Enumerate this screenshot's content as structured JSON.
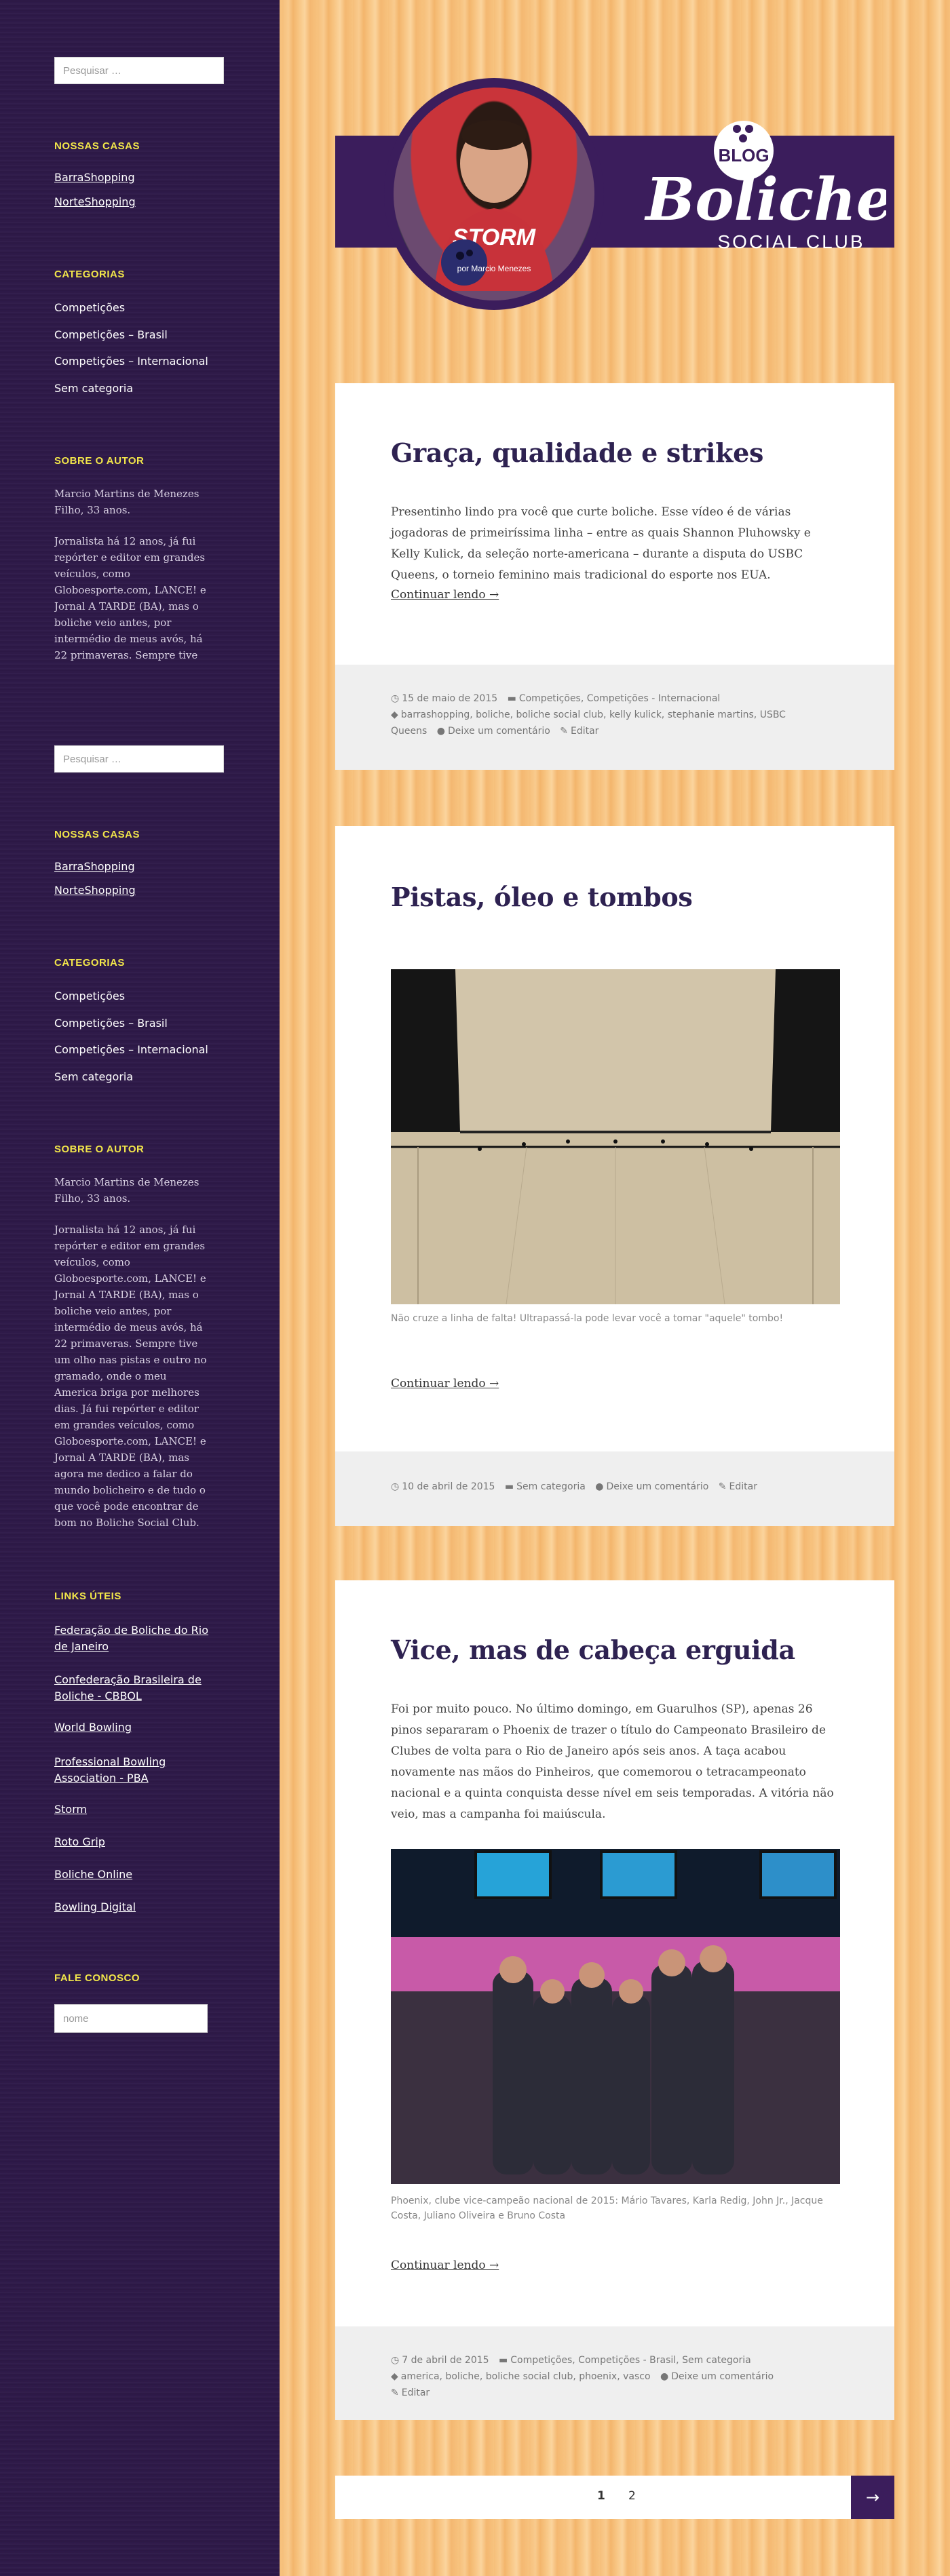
{
  "sidebar": {
    "search_placeholder": "Pesquisar …",
    "houses_title": "NOSSAS CASAS",
    "houses": [
      "BarraShopping",
      "NorteShopping"
    ],
    "categories_title": "CATEGORIAS",
    "categories": [
      "Competições",
      "Competições – Brasil",
      "Competições – Internacional",
      "Sem categoria"
    ],
    "author_title": "SOBRE O AUTOR",
    "author_short": "Marcio Martins de Menezes Filho, 33 anos.",
    "author_bio_truncated": "Jornalista há 12 anos, já fui repórter e editor em grandes veículos, como Globoesporte.com, LANCE! e Jornal A TARDE (BA), mas o boliche veio antes, por intermédio de meus avós, há 22 primaveras. Sempre tive um",
    "author_bio_full": "Jornalista há 12 anos, já fui repórter e editor em grandes veículos, como Globoesporte.com, LANCE! e Jornal A TARDE (BA), mas o boliche veio antes, por intermédio de meus avós, há 22 primaveras. Sempre tive um olho nas pistas e outro no gramado, onde o meu America briga por melhores dias. Já fui repórter e editor em grandes veículos, como Globoesporte.com, LANCE! e Jornal A TARDE (BA), mas agora me dedico a falar do mundo bolicheiro e de tudo o que você pode encontrar de bom no Boliche Social Club.",
    "links_title": "LINKS ÚTEIS",
    "links": [
      "Federação de Boliche do Rio de Janeiro",
      "Confederação Brasileira de Boliche - CBBOL",
      "World Bowling",
      "Professional Bowling Association - PBA",
      "Storm",
      "Roto Grip",
      "Boliche Online",
      "Bowling Digital"
    ],
    "contact_title": "FALE CONOSCO",
    "contact_placeholder": "nome"
  },
  "header": {
    "avatar_caption": "por Marcio Menezes",
    "logo_blog": "BLOG",
    "logo_main": "Boliche",
    "logo_sub": "SOCIAL CLUB"
  },
  "posts": [
    {
      "title": "Graça, qualidade e strikes",
      "excerpt": "Presentinho lindo pra você que curte boliche. Esse vídeo é de várias jogadoras de primeiríssima linha – entre as quais Shannon Pluhowsky e Kelly Kulick, da seleção norte-americana – durante a disputa do USBC Queens, o torneio feminino mais tradicional do esporte nos EUA.",
      "read_more": "Continuar lendo →",
      "date": "15 de maio de 2015",
      "categories": "Competições, Competições - Internacional",
      "tags": "barrashopping, boliche, boliche social club, kelly kulick, stephanie martins, USBC Queens",
      "comment": "Deixe um comentário",
      "edit": "Editar"
    },
    {
      "title": "Pistas, óleo e tombos",
      "caption": "Não cruze a linha de falta! Ultrapassá-la pode levar você a tomar \"aquele\" tombo!",
      "read_more": "Continuar lendo →",
      "date": "10 de abril de 2015",
      "categories": "Sem categoria",
      "comment": "Deixe um comentário",
      "edit": "Editar"
    },
    {
      "title": "Vice, mas de cabeça erguida",
      "excerpt": "Foi por muito pouco. No último domingo, em Guarulhos (SP), apenas 26 pinos separaram o Phoenix de trazer o título do Campeonato Brasileiro de Clubes de volta para o Rio de Janeiro após seis anos. A taça acabou novamente nas mãos do Pinheiros, que comemorou o tetracampeonato nacional e a quinta conquista desse nível em seis temporadas. A vitória não veio, mas a campanha foi maiúscula.",
      "caption": "Phoenix, clube vice-campeão nacional de 2015: Mário Tavares, Karla Redig, John Jr., Jacque Costa, Juliano Oliveira e Bruno Costa",
      "read_more": "Continuar lendo →",
      "date": "7 de abril de 2015",
      "categories": "Competições, Competições - Brasil, Sem categoria",
      "tags": "america, boliche, boliche social club, phoenix, vasco",
      "comment": "Deixe um comentário",
      "edit": "Editar"
    }
  ],
  "pagination": {
    "current": "1",
    "next_page": "2",
    "next_icon": "→"
  },
  "icons": {
    "date": "clock-icon",
    "category": "folder-icon",
    "tag": "tag-icon",
    "comment": "comment-icon",
    "edit": "pencil-icon"
  },
  "colors": {
    "brand_purple": "#3b1d5c",
    "title_color": "#2e2251",
    "widget_yellow": "#f2e64a"
  }
}
